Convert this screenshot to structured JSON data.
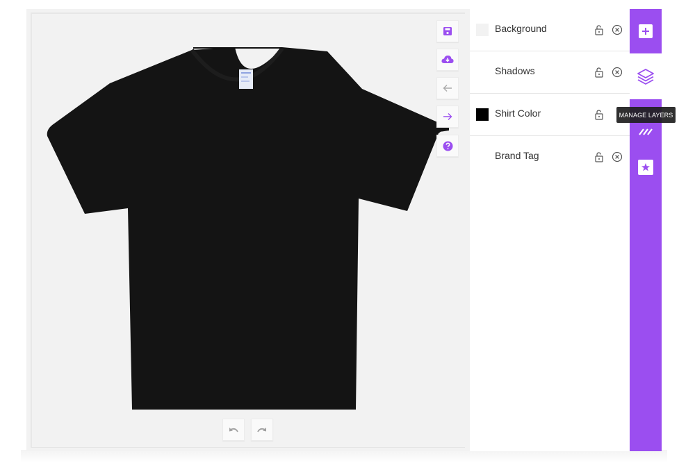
{
  "colors": {
    "accent": "#9b4ef0",
    "canvas_bg": "#f2f2f2",
    "shirt": "#141414"
  },
  "toolbar": {
    "save_icon": "save-icon",
    "download_icon": "cloud-download-icon",
    "back_icon": "arrow-left-icon",
    "forward_icon": "arrow-right-icon",
    "help_icon": "help-icon"
  },
  "history": {
    "undo_icon": "undo-icon",
    "redo_icon": "redo-icon"
  },
  "layers": [
    {
      "label": "Background",
      "swatch": "#f2f2f2",
      "has_swatch": true
    },
    {
      "label": "Shadows",
      "swatch": null,
      "has_swatch": false
    },
    {
      "label": "Shirt Color",
      "swatch": "#000000",
      "has_swatch": true
    },
    {
      "label": "Brand Tag",
      "swatch": null,
      "has_swatch": false
    }
  ],
  "sidebar": {
    "items": [
      {
        "name": "add",
        "icon": "plus-icon",
        "active": true
      },
      {
        "name": "layers",
        "icon": "layers-icon",
        "active": false
      },
      {
        "name": "patterns",
        "icon": "pattern-icon",
        "active": true
      },
      {
        "name": "favorites",
        "icon": "star-icon",
        "active": true
      }
    ]
  },
  "tooltip": {
    "text": "MANAGE LAYERS"
  }
}
